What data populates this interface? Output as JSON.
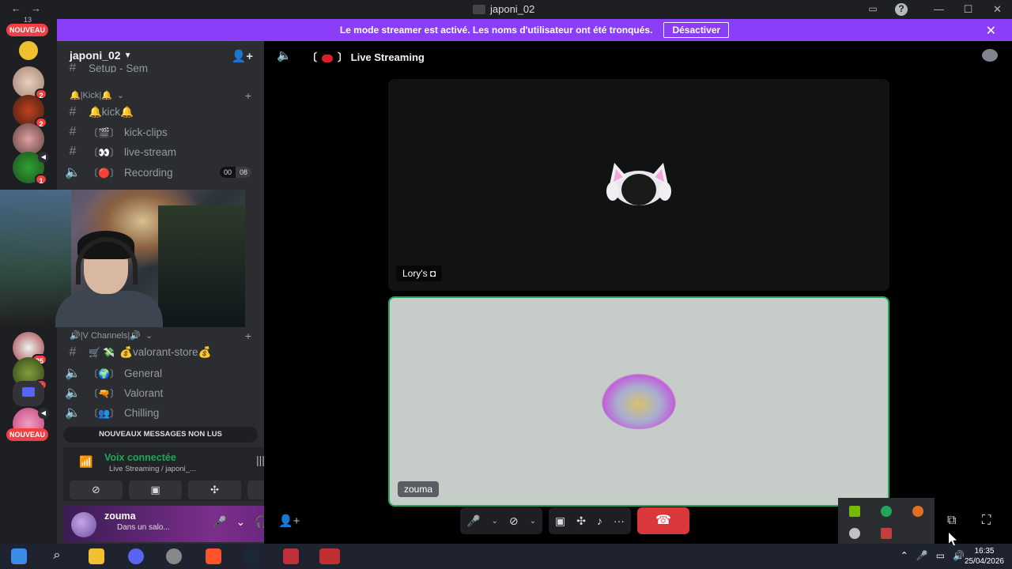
{
  "window": {
    "title": "japoni_02"
  },
  "banner": {
    "text": "Le mode streamer est activé. Les noms d'utilisateur ont été tronqués.",
    "button": "Désactiver"
  },
  "servers": {
    "top_count": "13",
    "nouveau_label": "NOUVEAU",
    "badges": [
      "2",
      "2",
      "1",
      "25",
      "3"
    ]
  },
  "channels": {
    "server_name": "japoni_02",
    "partial_top": "Setup - Sem",
    "categories": [
      {
        "label": "🔔|Kick|🔔"
      },
      {
        "label": "🔊|V Channels|🔊"
      }
    ],
    "kick_items": [
      {
        "type": "text",
        "name": "🔔kick🔔"
      },
      {
        "type": "text",
        "prefix": "〔🎬〕",
        "name": "kick-clips"
      },
      {
        "type": "text",
        "prefix": "〔👀〕",
        "name": "live-stream"
      },
      {
        "type": "voice",
        "prefix": "〔🔴〕",
        "name": "Recording",
        "pill": [
          "00",
          "08"
        ]
      }
    ],
    "vc_items": [
      {
        "type": "text",
        "prefix": "🛒 💸",
        "name": "💰valorant-store💰"
      },
      {
        "type": "voice",
        "prefix": "〔🌍〕",
        "name": "General"
      },
      {
        "type": "voice",
        "prefix": "〔🔫〕",
        "name": "Valorant"
      },
      {
        "type": "voice",
        "prefix": "〔👥〕",
        "name": "Chilling"
      }
    ],
    "unread": "NOUVEAUX MESSAGES NON LUS"
  },
  "voice": {
    "status": "Voix connectée",
    "location": "Live Streaming / japoni_..."
  },
  "user": {
    "name": "zouma",
    "status": "Dans un salo..."
  },
  "main": {
    "channel_title": "Live Streaming",
    "tiles": [
      {
        "name": "Lory's ◘"
      },
      {
        "name": "zouma"
      }
    ]
  },
  "taskbar": {
    "time": "16:35",
    "date": "25/04/2026"
  },
  "colors": {
    "banner": "#8b3df7",
    "connected": "#23a55a",
    "end_call": "#da373c",
    "badge": "#f23f42"
  }
}
